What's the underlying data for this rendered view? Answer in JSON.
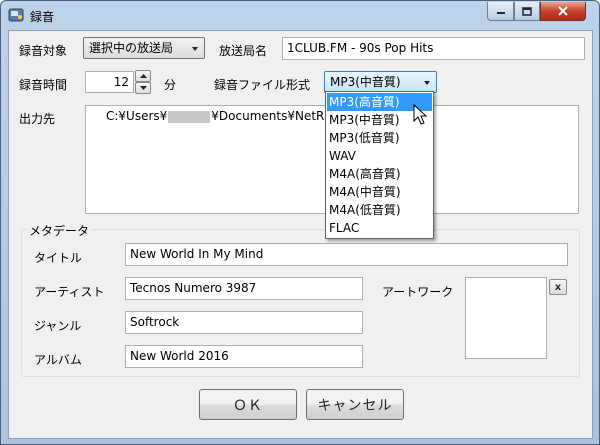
{
  "window": {
    "title": "録音"
  },
  "form": {
    "target_label": "録音対象",
    "target_value": "選択中の放送局",
    "station_label": "放送局名",
    "station_value": "1CLUB.FM - 90s Pop Hits",
    "duration_label": "録音時間",
    "duration_value": "12",
    "duration_unit": "分",
    "format_label": "録音ファイル形式",
    "format_value": "MP3(中音質)",
    "output_label": "出力先",
    "output_path_prefix": "C:¥Users¥",
    "output_path_suffix": "¥Documents¥NetRad"
  },
  "format_dropdown": {
    "options": [
      "MP3(高音質)",
      "MP3(中音質)",
      "MP3(低音質)",
      "WAV",
      "M4A(高音質)",
      "M4A(中音質)",
      "M4A(低音質)",
      "FLAC"
    ],
    "highlighted_index": 0
  },
  "metadata": {
    "group_label": "メタデータ",
    "title_label": "タイトル",
    "title_value": "New World In My Mind",
    "artist_label": "アーティスト",
    "artist_value": "Tecnos Numero 3987",
    "genre_label": "ジャンル",
    "genre_value": "Softrock",
    "album_label": "アルバム",
    "album_value": "New World 2016",
    "artwork_label": "アートワーク",
    "artwork_clear": "x"
  },
  "buttons": {
    "ok": "ＯＫ",
    "cancel": "キャンセル"
  },
  "colors": {
    "selection": "#3399ff",
    "titlebar": "#bcd3ea",
    "close": "#c7432b"
  }
}
